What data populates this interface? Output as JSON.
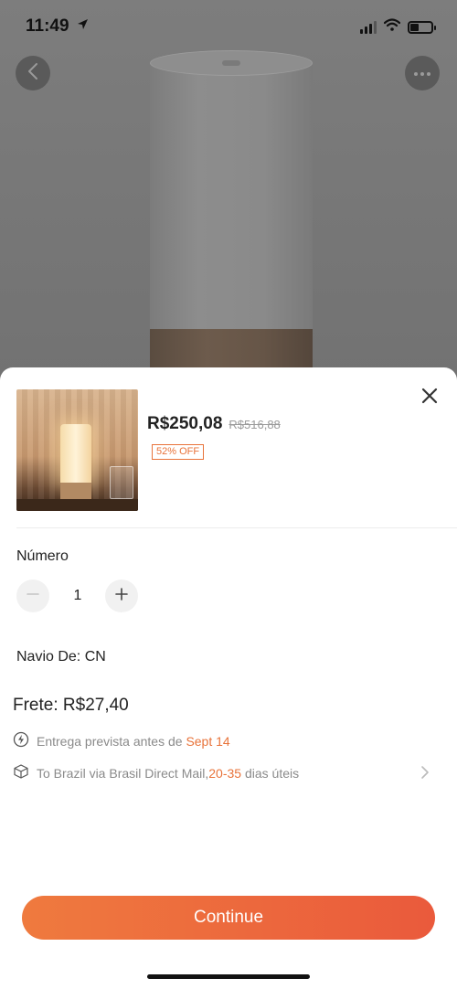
{
  "status_bar": {
    "time": "11:49"
  },
  "product": {
    "price": "R$250,08",
    "original_price": "R$516,88",
    "discount": "52% OFF"
  },
  "quantity": {
    "label": "Número",
    "value": "1"
  },
  "ship_from": "Navio De: CN",
  "freight": "Frete: R$27,40",
  "delivery": {
    "text": "Entrega prevista antes de ",
    "date": "Sept 14"
  },
  "shipping": {
    "text": "To Brazil via Brasil Direct Mail,",
    "range": "20-35",
    "suffix": " dias úteis"
  },
  "continue_label": "Continue",
  "colors": {
    "accent": "#e8733a",
    "button_start": "#ef7a3e",
    "button_end": "#ea5a3c"
  },
  "icons": {
    "back": "chevron-left-icon",
    "more": "more-horizontal-icon",
    "close": "close-icon",
    "minus": "minus-icon",
    "plus": "plus-icon",
    "delivery": "lightning-icon",
    "shipping": "package-icon",
    "chevron": "chevron-right-icon"
  }
}
